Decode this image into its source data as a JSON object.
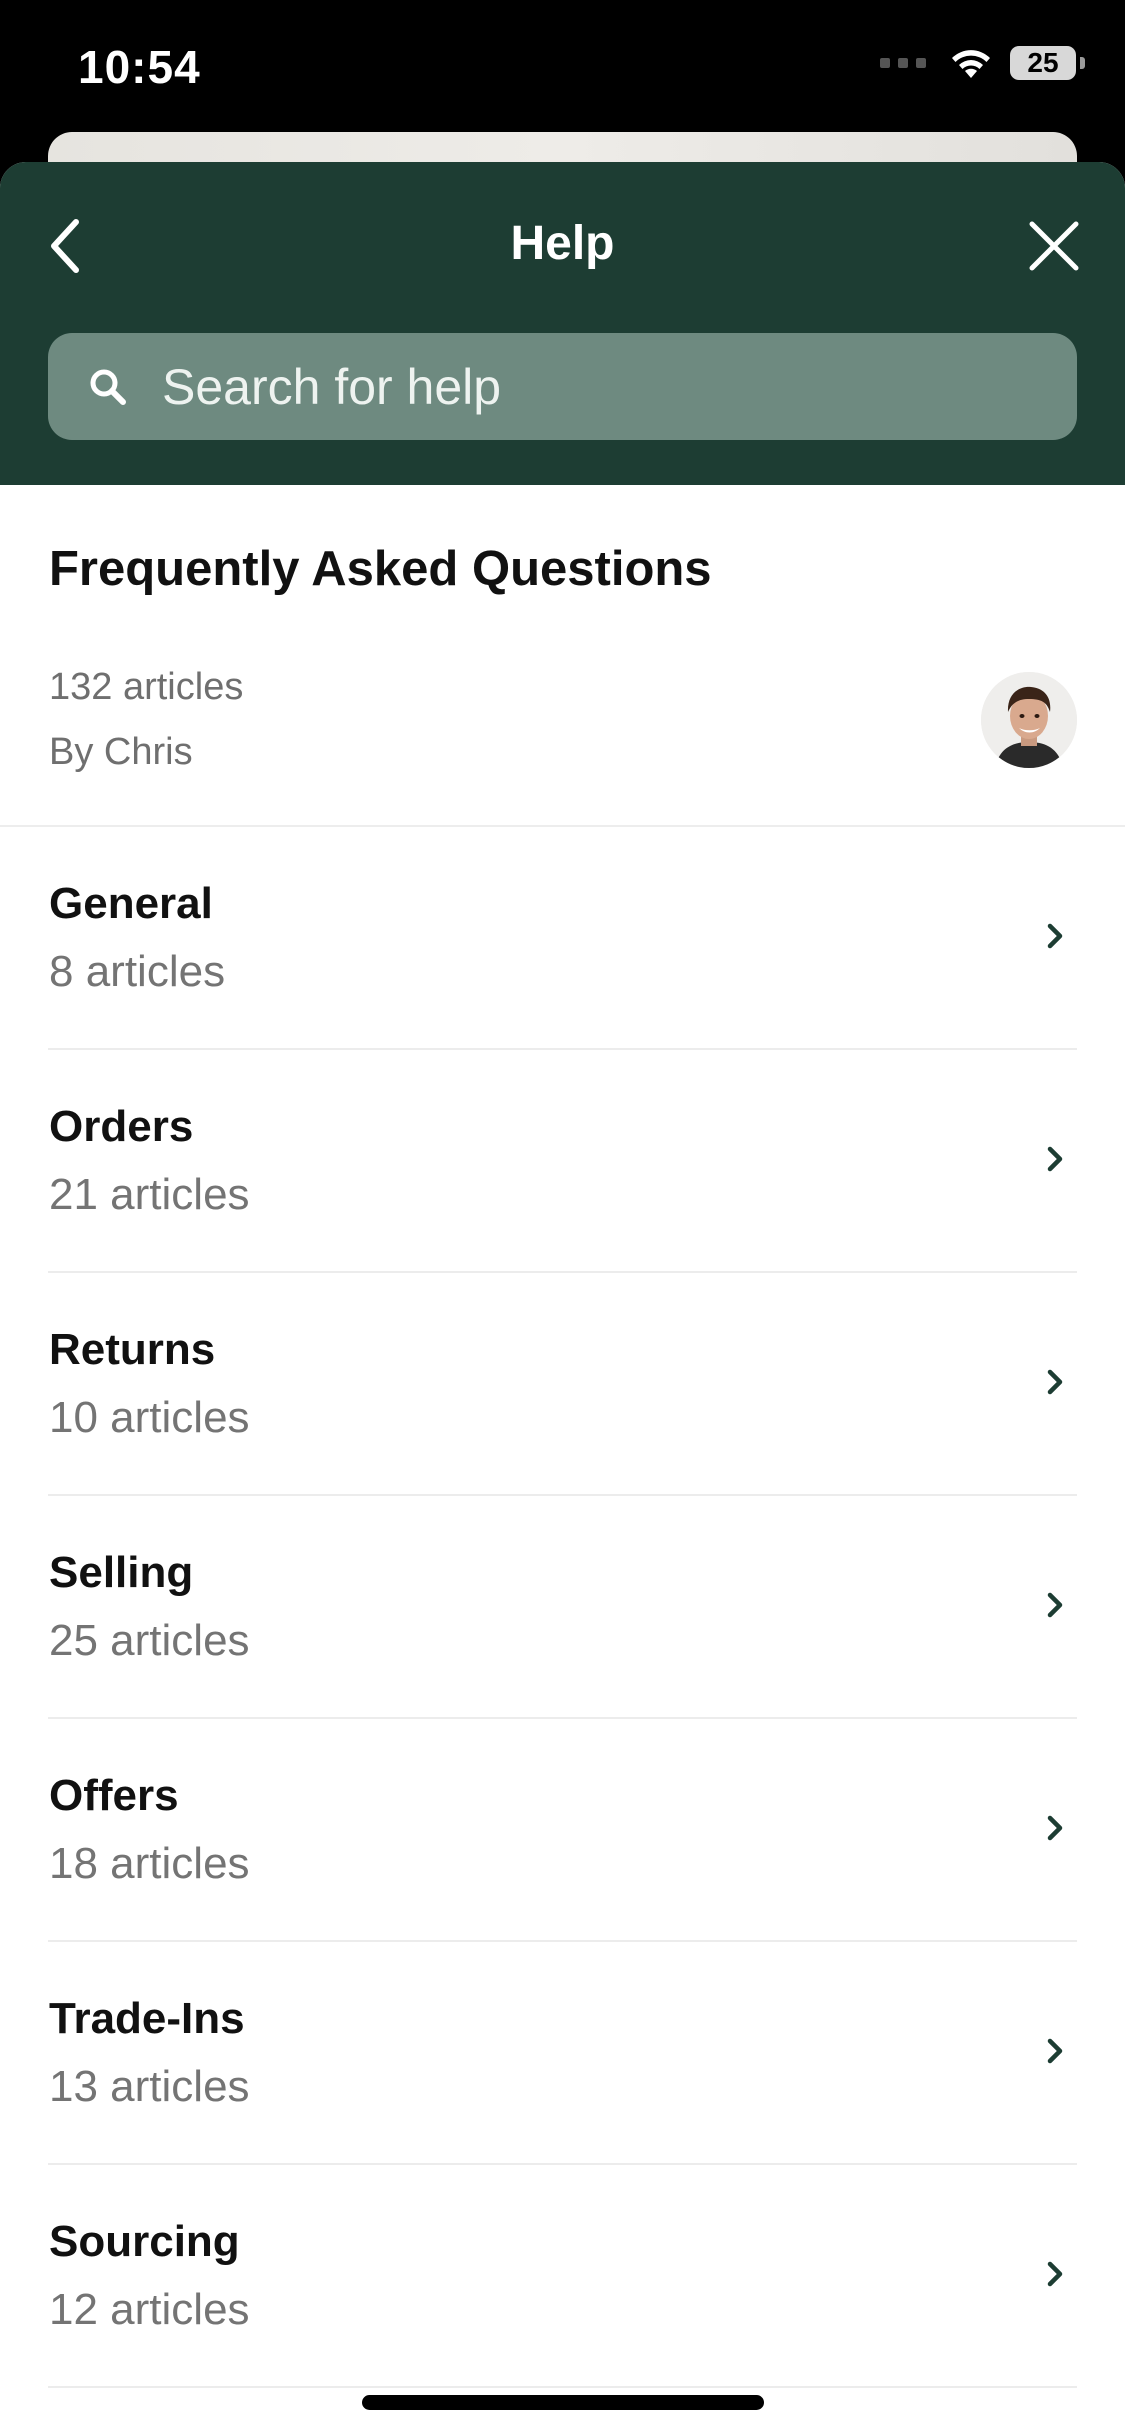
{
  "status_bar": {
    "time": "10:54",
    "battery": "25"
  },
  "header": {
    "title": "Help"
  },
  "search": {
    "placeholder": "Search for help"
  },
  "faq": {
    "title": "Frequently Asked Questions",
    "article_count": "132 articles",
    "author": "By Chris"
  },
  "categories": [
    {
      "name": "General",
      "count": "8 articles"
    },
    {
      "name": "Orders",
      "count": "21 articles"
    },
    {
      "name": "Returns",
      "count": "10 articles"
    },
    {
      "name": "Selling",
      "count": "25 articles"
    },
    {
      "name": "Offers",
      "count": "18 articles"
    },
    {
      "name": "Trade-Ins",
      "count": "13 articles"
    },
    {
      "name": "Sourcing",
      "count": "12 articles"
    }
  ],
  "icons": {
    "back": "chevron-left-icon",
    "close": "close-icon",
    "search": "search-icon",
    "row": "chevron-right-icon"
  },
  "colors": {
    "header_bg": "#1d3d33",
    "search_bg": "#6e8a80",
    "chevron": "#1d3d33"
  }
}
